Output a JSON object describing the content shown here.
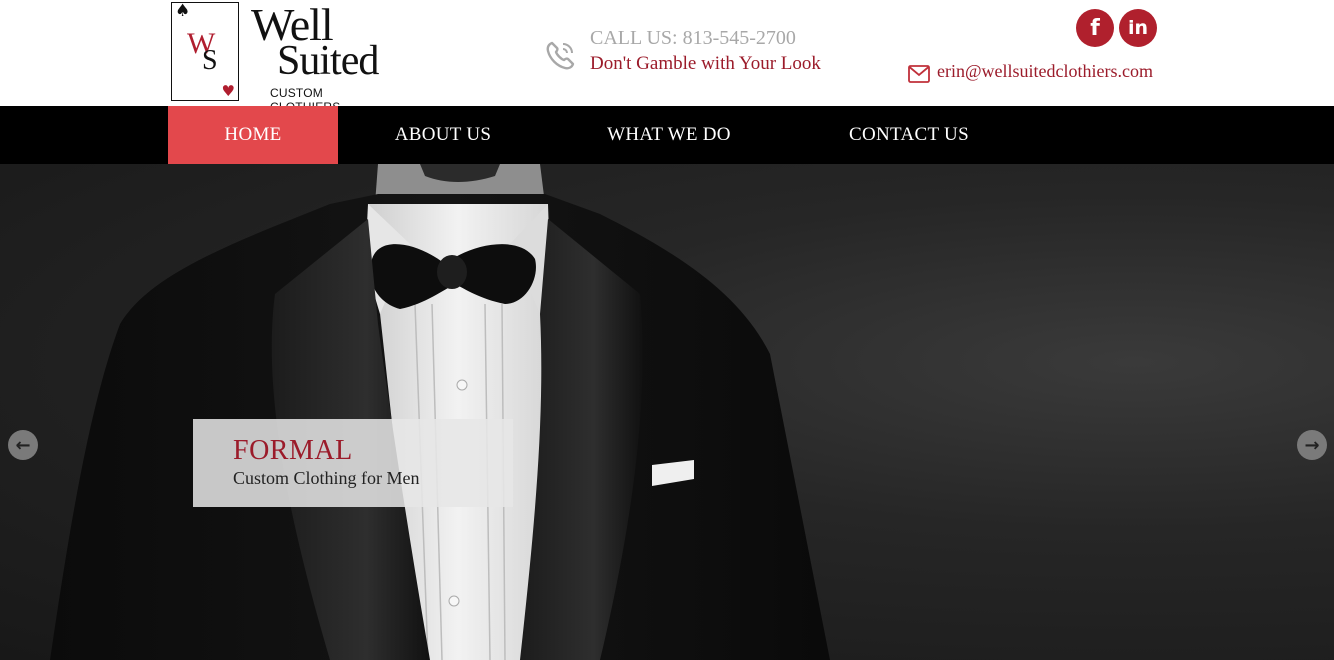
{
  "logo": {
    "word1": "Well",
    "word2": "Suited",
    "subtitle": "CUSTOM CLOTHIERS",
    "monogram_w": "W",
    "monogram_s": "S"
  },
  "contact": {
    "call": "CALL US: 813-545-2700",
    "tagline": "Don't Gamble with Your Look",
    "email": "erin@wellsuitedclothiers.com",
    "phone_icon": "phone-icon",
    "mail_icon": "mail-icon"
  },
  "social": {
    "facebook_glyph": "f",
    "linkedin_glyph": "in",
    "color": "#b0202d"
  },
  "nav": {
    "items": [
      {
        "label": "HOME",
        "active": true
      },
      {
        "label": "ABOUT US",
        "active": false
      },
      {
        "label": "WHAT WE DO",
        "active": false
      },
      {
        "label": "CONTACT US",
        "active": false
      }
    ],
    "active_color": "#e3484c"
  },
  "slider": {
    "caption_title": "FORMAL",
    "caption_subtitle": "Custom Clothing for Men",
    "prev_glyph": "←",
    "next_glyph": "→"
  },
  "colors": {
    "brand_red": "#9b1b2a",
    "nav_bg": "#000000"
  }
}
